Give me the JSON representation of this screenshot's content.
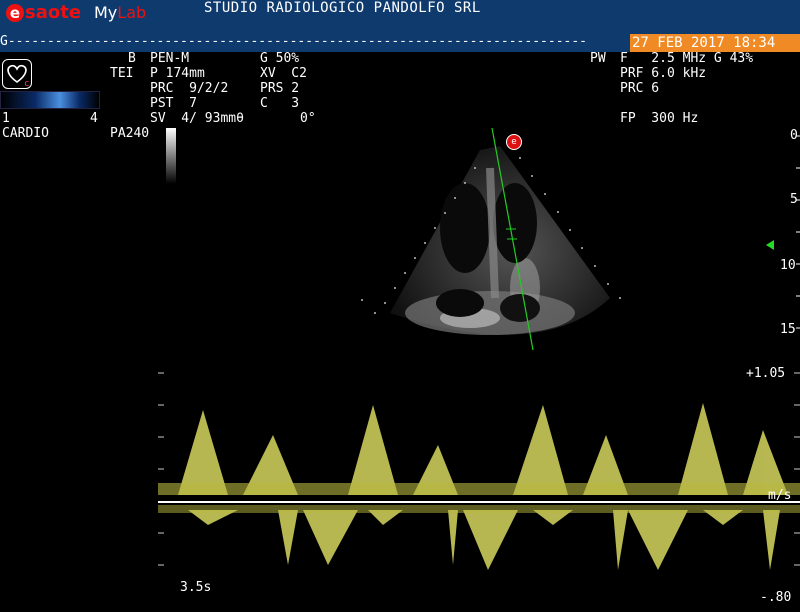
{
  "header": {
    "logo_mark": "e",
    "logo_brand": "saote",
    "logo_my": "My",
    "logo_lab": "Lab",
    "studio_name": "STUDIO RADIOLOGICO PANDOLFO SRL",
    "g_line": "G--------------------------------------------------------------------------",
    "date_time": "27 FEB 2017 18:34"
  },
  "left_params": {
    "heart_badge": "c",
    "range_left": "1",
    "range_right": "4",
    "preset": "CARDIO",
    "probe": "PA240"
  },
  "b_params": {
    "line1_label": "B",
    "line1_val": "PEN-M",
    "line1_g": "G 50%",
    "line2_label": "TEI",
    "line2_val": "P 174mm",
    "line2_xv": "XV  C2",
    "line3_val": "PRC  9/2/2",
    "line3_prs": "PRS 2",
    "line4_val": "PST  7",
    "line4_c": "C   3",
    "line5_val": "SV  4/ 93mmθ",
    "line5_angle": "0°"
  },
  "pw_params": {
    "pw_label": "PW",
    "f_val": "F   2.5 MHz G 43%",
    "prf_val": "PRF 6.0 kHz",
    "prc_val": "PRC 6",
    "fp_val": "FP  300 Hz"
  },
  "depth_scale": {
    "d0": "0",
    "d5": "5",
    "d10": "10",
    "d15": "15"
  },
  "doppler": {
    "top_scale": "+1.05",
    "unit": "m/s",
    "bottom_scale": "-.80",
    "sweep_time": "3.5s"
  },
  "colors": {
    "header_bg": "#0f3a6e",
    "date_bg": "#f08a24",
    "doppler_yellow": "#e0e060",
    "marker_green": "#22dd22",
    "sample_line": "#22cc22"
  }
}
